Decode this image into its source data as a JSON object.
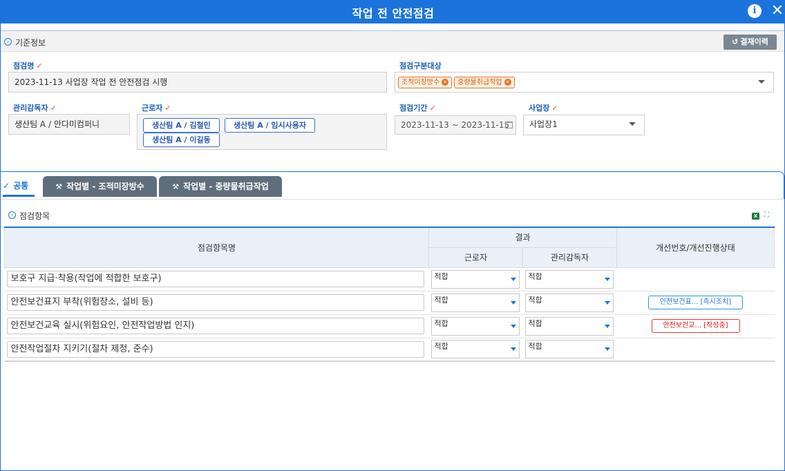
{
  "window": {
    "title": "작업 전 안전점검"
  },
  "basic_info": {
    "section_title": "기준정보",
    "history_button": "결재이력",
    "inspection_name": {
      "label": "점검명",
      "value": "2023-11-13 사업장 작업 전 안전점검 시행"
    },
    "inspection_target": {
      "label": "점검구분대상",
      "tags": [
        "조적미장방수",
        "중량물취급작업"
      ]
    },
    "supervisor": {
      "label": "관리감독자",
      "value": "생산팀 A / 안다미컴퍼니"
    },
    "workers": {
      "label": "근로자",
      "tags": [
        "생산팀 A / 김철민",
        "생산팀 A / 임시사용자",
        "생산팀 A / 이길동"
      ]
    },
    "period": {
      "label": "점검기간",
      "value": "2023-11-13 ~ 2023-11-15"
    },
    "site": {
      "label": "사업장",
      "value": "사업장1"
    }
  },
  "tabs": [
    {
      "label": "공통",
      "active": true
    },
    {
      "label": "작업별 - 조적미장방수",
      "active": false
    },
    {
      "label": "작업별 - 중량물취급작업",
      "active": false
    }
  ],
  "inspection_items": {
    "section_title": "점검항목",
    "headers": {
      "item_name": "점검항목명",
      "result": "결과",
      "worker": "근로자",
      "supervisor": "관리감독자",
      "improvement": "개선번호/개선진행상태"
    },
    "rows": [
      {
        "name": "보호구 지급·착용(작업에 적합한 보호구)",
        "worker": "적합",
        "supervisor": "적합",
        "status": "",
        "status_color": ""
      },
      {
        "name": "안전보건표지 부착(위험장소, 설비 등)",
        "worker": "적합",
        "supervisor": "적합",
        "status": "안전보건표... [즉시조치]",
        "status_color": "#1b74dc"
      },
      {
        "name": "안전보건교육 실시(위험요인, 안전작업방법 인지)",
        "worker": "적합",
        "supervisor": "적합",
        "status": "안전보건교... [작성중]",
        "status_color": "#dd1111"
      },
      {
        "name": "안전작업절차 지키기(절차 제정, 준수)",
        "worker": "적합",
        "supervisor": "적합",
        "status": "",
        "status_color": ""
      }
    ]
  }
}
